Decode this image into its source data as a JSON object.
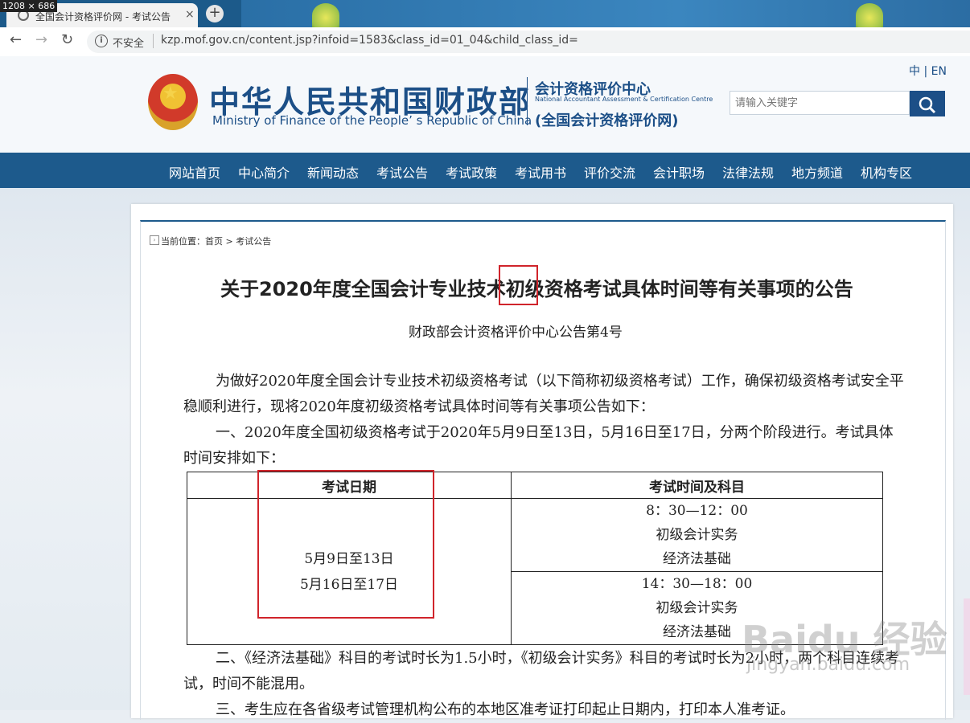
{
  "browser": {
    "dimension_label": "1208 × 686",
    "tab_title": "全国会计资格评价网 - 考试公告",
    "tab_close": "×",
    "new_tab": "+",
    "insecure_label": "不安全",
    "url": "kzp.mof.gov.cn/content.jsp?infoid=1583&class_id=01_04&child_class_id="
  },
  "header": {
    "title_cn": "中华人民共和国财政部",
    "title_en": "Ministry of Finance of the People’ s Republic of China",
    "center_cn": "会计资格评价中心",
    "center_en": "National Accountant Assessment & Certification Centre",
    "center_net": "(全国会计资格评价网)",
    "lang": "中 | EN",
    "search_placeholder": "请输入关键字"
  },
  "nav": [
    "网站首页",
    "中心简介",
    "新闻动态",
    "考试公告",
    "考试政策",
    "考试用书",
    "评价交流",
    "会计职场",
    "法律法规",
    "地方频道",
    "机构专区"
  ],
  "breadcrumb": "当前位置：首页 > 考试公告",
  "article": {
    "title": "关于2020年度全国会计专业技术初级资格考试具体时间等有关事项的公告",
    "doc_no": "财政部会计资格评价中心公告第4号",
    "p1": "为做好2020年度全国会计专业技术初级资格考试（以下简称初级资格考试）工作，确保初级资格考试安全平稳顺利进行，现将2020年度初级资格考试具体时间等有关事项公告如下：",
    "p2": "一、2020年度全国初级资格考试于2020年5月9日至13日，5月16日至17日，分两个阶段进行。考试具体时间安排如下：",
    "table": {
      "h1": "考试日期",
      "h2": "考试时间及科目",
      "date1": "5月9日至13日",
      "date2": "5月16日至17日",
      "s1_time": "8：30—12：00",
      "s1_sub1": "初级会计实务",
      "s1_sub2": "经济法基础",
      "s2_time": "14：30—18：00",
      "s2_sub1": "初级会计实务",
      "s2_sub2": "经济法基础"
    },
    "p3": "二、《经济法基础》科目的考试时长为1.5小时，《初级会计实务》科目的考试时长为2小时，两个科目连续考试，时间不能混用。",
    "p4": "三、考生应在各省级考试管理机构公布的本地区准考证打印起止日期内，打印本人准考证。"
  },
  "watermark": {
    "main": "Baidu 经验",
    "sub": "jingyan.baidu.com"
  }
}
